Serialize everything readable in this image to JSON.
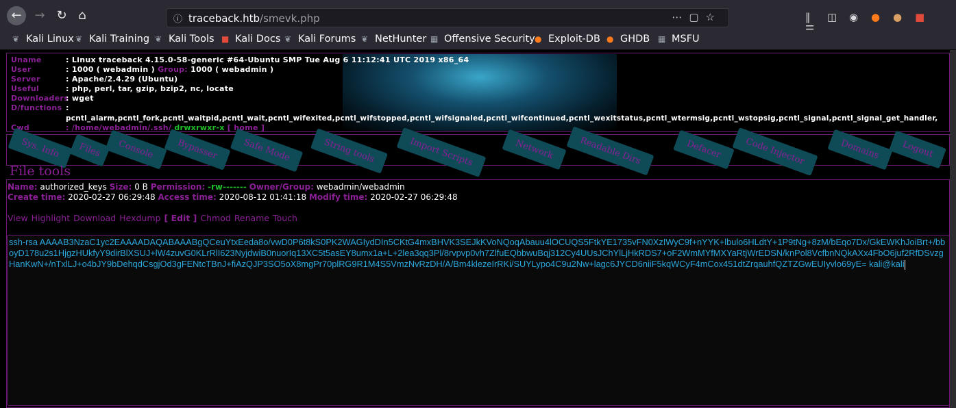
{
  "browser": {
    "url_host": "traceback.htb",
    "url_path": "/smevk.php",
    "bookmarks": [
      "Kali Linux",
      "Kali Training",
      "Kali Tools",
      "Kali Docs",
      "Kali Forums",
      "NetHunter",
      "Offensive Security",
      "Exploit-DB",
      "GHDB",
      "MSFU"
    ]
  },
  "sysinfo": {
    "uname_label": "Uname",
    "uname": ": Linux traceback 4.15.0-58-generic #64-Ubuntu SMP Tue Aug 6 11:12:41 UTC 2019 x86_64",
    "user_label": "User",
    "user": ": 1000 ( webadmin )",
    "group_label": "Group:",
    "group": "1000 ( webadmin )",
    "server_label": "Server",
    "server": ": Apache/2.4.29 (Ubuntu)",
    "useful_label": "Useful",
    "useful": ": php, perl, tar, gzip, bzip2, nc, locate",
    "downloaders_label": "Downloaders",
    "downloaders": ": wget",
    "dfunctions_label": "D/functions",
    "dfunctions_colon": ":",
    "dfunctions": "pcntl_alarm,pcntl_fork,pcntl_waitpid,pcntl_wait,pcntl_wifexited,pcntl_wifstopped,pcntl_wifsignaled,pcntl_wifcontinued,pcntl_wexitstatus,pcntl_wtermsig,pcntl_wstopsig,pcntl_signal,pcntl_signal_get_handler,",
    "cwd_label": "Cwd",
    "cwd": ": /home/webadmin/.ssh/",
    "cwd_perm": "drwxrwxr-x",
    "cwd_home": "[ home ]"
  },
  "menu": [
    "Sys. Info",
    "Files",
    "Console",
    "Bypasser",
    "Safe Mode",
    "String tools",
    "Import Scripts",
    "Network",
    "Readable Dirs",
    "Defacer",
    "Code Injector",
    "Domains",
    "Logout"
  ],
  "file_tools": {
    "title": "File tools",
    "name_label": "Name:",
    "name": "authorized_keys",
    "size_label": "Size:",
    "size": "0 B",
    "perm_label": "Permission:",
    "perm": "-rw-------",
    "owner_label": "Owner/Group:",
    "owner": "webadmin/webadmin",
    "create_label": "Create time:",
    "create": "2020-02-27 06:29:48",
    "access_label": "Access time:",
    "access": "2020-08-12 01:41:18",
    "modify_label": "Modify time:",
    "modify": "2020-02-27 06:29:48",
    "actions": [
      "View",
      "Highlight",
      "Download",
      "Hexdump",
      "[ Edit ]",
      "Chmod",
      "Rename",
      "Touch"
    ],
    "content": "ssh-rsa AAAAB3NzaC1yc2EAAAADAQABAAABgQCeuYtxEeda8o/vwD0P6t8kS0PK2WAGIydDIn5CKtG4mxBHVK3SEJkKVoNQoqAbauu4lOCUQS5FtkYE1735vFN0XzIWyC9f+nYYK+lbulo6HLdtY+1P9tNg+8zM/bEqo7Dx/GkEWKhJoiBrt+/bboyD178u2s1HjgzHUkfyY9dirBlXSUJ+lW4zuvG0KLrRlI623NyjdwiB0nuorIq13XC5t5asEY8umx1a+L+2lea3qq3Pl/8rvpvp0vh7ZlfuEQbbwuBqj312Cy4UUsJChYlLjHkRDS7+oF2WmMYfMXYaRtjWrEDSN/knPol8VcfbnNQkAXx4FbO6juf2RfDSvzgHanKwN+/nTxlLJ+o4bJY9bDehqdCsgjOd3gFENtcTBnJ+fiAzQJP3SO5oX8mgPr70plRG9R1M4S5VmzNvRzDH/A/Bm4klezeIrRKi/SUYLypo4C9u2Nw+lagc6JYCD6niiF5kqWCyF4mCox451dtZrqauhfQZTZGwEUIyvlo69yE= kali@kali"
  }
}
